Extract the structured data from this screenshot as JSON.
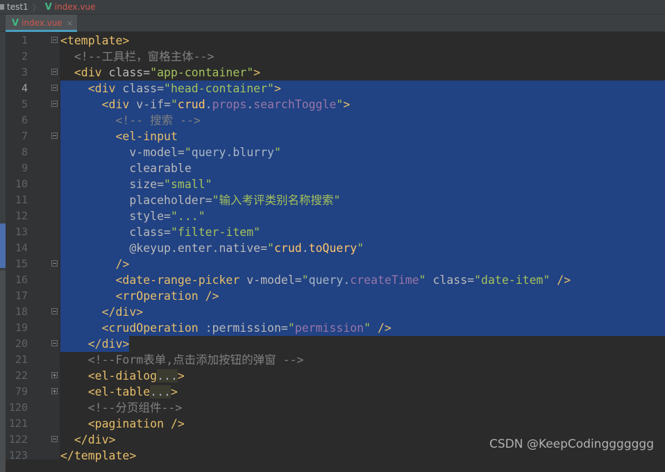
{
  "breadcrumb": {
    "project": "test1",
    "file": "index.vue"
  },
  "tab": {
    "label": "index.vue",
    "close": "×"
  },
  "watermark": "CSDN @KeepCodinggggggg",
  "lines": [
    {
      "n": "1",
      "fold": "minus",
      "sel": 0,
      "seg": [
        [
          "t",
          "<template>"
        ]
      ]
    },
    {
      "n": "2",
      "seg": [
        [
          "j",
          "  "
        ],
        [
          "c",
          "<!--工具栏，窗格主体-->"
        ]
      ]
    },
    {
      "n": "3",
      "fold": "minus",
      "seg": [
        [
          "j",
          "  "
        ],
        [
          "t",
          "<div "
        ],
        [
          "a",
          "class="
        ],
        [
          "s",
          "\"app-container\""
        ],
        [
          "t",
          ">"
        ]
      ]
    },
    {
      "n": "4",
      "fold": "minus",
      "sel": "full",
      "seg": [
        [
          "j",
          "    "
        ],
        [
          "t",
          "<div "
        ],
        [
          "a",
          "class="
        ],
        [
          "s",
          "\"head-container\""
        ],
        [
          "t",
          ">"
        ]
      ]
    },
    {
      "n": "5",
      "fold": "minus",
      "sel": "full",
      "seg": [
        [
          "j",
          "      "
        ],
        [
          "t",
          "<div "
        ],
        [
          "a",
          "v-if="
        ],
        [
          "s",
          "\""
        ],
        [
          "y",
          "crud"
        ],
        [
          "j",
          "."
        ],
        [
          "p",
          "props"
        ],
        [
          "j",
          "."
        ],
        [
          "p",
          "searchToggle"
        ],
        [
          "s",
          "\""
        ],
        [
          "t",
          ">"
        ]
      ]
    },
    {
      "n": "6",
      "sel": "full",
      "seg": [
        [
          "j",
          "        "
        ],
        [
          "c",
          "<!-- 搜索 -->"
        ]
      ]
    },
    {
      "n": "7",
      "fold": "minus",
      "sel": "full",
      "seg": [
        [
          "j",
          "        "
        ],
        [
          "t",
          "<el-input"
        ]
      ]
    },
    {
      "n": "8",
      "sel": "full",
      "seg": [
        [
          "j",
          "          "
        ],
        [
          "a",
          "v-model="
        ],
        [
          "s",
          "\""
        ],
        [
          "j",
          "query.blurry"
        ],
        [
          "s",
          "\""
        ]
      ]
    },
    {
      "n": "9",
      "sel": "full",
      "seg": [
        [
          "j",
          "          "
        ],
        [
          "a",
          "clearable"
        ]
      ]
    },
    {
      "n": "10",
      "sel": "full",
      "seg": [
        [
          "j",
          "          "
        ],
        [
          "a",
          "size="
        ],
        [
          "s",
          "\"small\""
        ]
      ]
    },
    {
      "n": "11",
      "sel": "full",
      "seg": [
        [
          "j",
          "          "
        ],
        [
          "a",
          "placeholder="
        ],
        [
          "s",
          "\"输入考评类别名称搜索\""
        ]
      ]
    },
    {
      "n": "12",
      "sel": "full",
      "seg": [
        [
          "j",
          "          "
        ],
        [
          "a",
          "style="
        ],
        [
          "s",
          "\"...\""
        ]
      ]
    },
    {
      "n": "13",
      "sel": "full",
      "seg": [
        [
          "j",
          "          "
        ],
        [
          "a",
          "class="
        ],
        [
          "s",
          "\"filter-item\""
        ]
      ]
    },
    {
      "n": "14",
      "sel": "full",
      "seg": [
        [
          "j",
          "          "
        ],
        [
          "a",
          "@keyup.enter.native="
        ],
        [
          "s",
          "\""
        ],
        [
          "y",
          "crud"
        ],
        [
          "j",
          "."
        ],
        [
          "y",
          "toQuery"
        ],
        [
          "s",
          "\""
        ]
      ]
    },
    {
      "n": "15",
      "fold": "minus",
      "sel": "full",
      "seg": [
        [
          "j",
          "        "
        ],
        [
          "t",
          "/>"
        ]
      ]
    },
    {
      "n": "16",
      "sel": "full",
      "seg": [
        [
          "j",
          "        "
        ],
        [
          "t",
          "<date-range-picker "
        ],
        [
          "a",
          "v-model="
        ],
        [
          "s",
          "\""
        ],
        [
          "j",
          "query."
        ],
        [
          "p",
          "createTime"
        ],
        [
          "s",
          "\""
        ],
        [
          "a",
          " class="
        ],
        [
          "s",
          "\"date-item\""
        ],
        [
          "t",
          " />"
        ]
      ]
    },
    {
      "n": "17",
      "sel": "full",
      "seg": [
        [
          "j",
          "        "
        ],
        [
          "t",
          "<rrOperation />"
        ]
      ]
    },
    {
      "n": "18",
      "fold": "minus",
      "sel": "full",
      "seg": [
        [
          "j",
          "      "
        ],
        [
          "t",
          "</div>"
        ]
      ]
    },
    {
      "n": "19",
      "sel": "full",
      "seg": [
        [
          "j",
          "      "
        ],
        [
          "t",
          "<crudOperation "
        ],
        [
          "a",
          ":permission="
        ],
        [
          "s",
          "\""
        ],
        [
          "p",
          "permission"
        ],
        [
          "s",
          "\""
        ],
        [
          "t",
          " />"
        ]
      ]
    },
    {
      "n": "20",
      "fold": "minus",
      "sel": "part",
      "seg": [
        [
          "j",
          "    "
        ],
        [
          "t",
          "</div>"
        ]
      ]
    },
    {
      "n": "21",
      "seg": [
        [
          "j",
          "    "
        ],
        [
          "c",
          "<!--Form表单,点击添加按钮的弹窗 -->"
        ]
      ]
    },
    {
      "n": "22",
      "fold": "plus",
      "seg": [
        [
          "j",
          "    "
        ],
        [
          "t",
          "<el-dialog"
        ],
        [
          "fd",
          "..."
        ],
        [
          "t",
          ">"
        ]
      ]
    },
    {
      "n": "79",
      "fold": "plus",
      "seg": [
        [
          "j",
          "    "
        ],
        [
          "t",
          "<el-table"
        ],
        [
          "fd",
          "..."
        ],
        [
          "t",
          ">"
        ]
      ]
    },
    {
      "n": "120",
      "seg": [
        [
          "j",
          "    "
        ],
        [
          "c",
          "<!--分页组件-->"
        ]
      ]
    },
    {
      "n": "121",
      "seg": [
        [
          "j",
          "    "
        ],
        [
          "t",
          "<pagination />"
        ]
      ]
    },
    {
      "n": "122",
      "fold": "minus",
      "seg": [
        [
          "j",
          "  "
        ],
        [
          "t",
          "</div>"
        ]
      ]
    },
    {
      "n": "123",
      "seg": [
        [
          "t",
          "</template>"
        ]
      ]
    }
  ]
}
